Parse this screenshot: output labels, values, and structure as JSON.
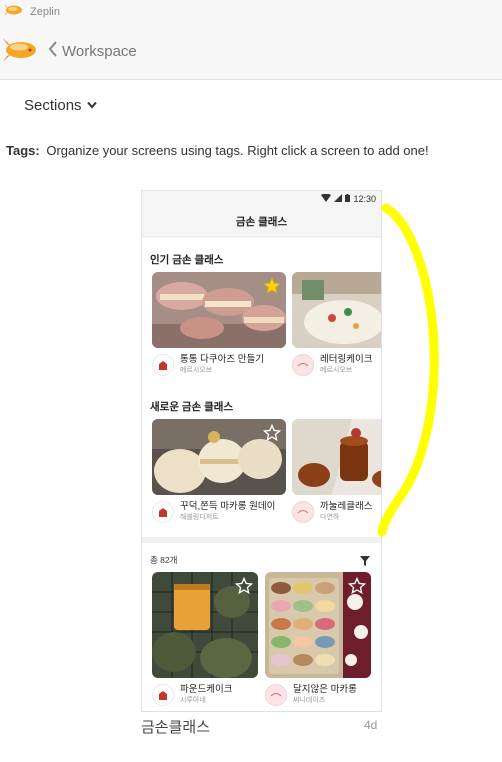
{
  "app": {
    "title": "Zeplin"
  },
  "nav": {
    "back_label": "Workspace"
  },
  "sections": {
    "label": "Sections"
  },
  "tags": {
    "label": "Tags:",
    "text": "Organize your screens using tags. Right click a screen to add one!"
  },
  "screen": {
    "name": "금손클래스",
    "age": "4d",
    "status_time": "12:30",
    "appbar_title": "금손 클래스",
    "popular": {
      "title": "인기 금손 클래스",
      "items": [
        {
          "title": "통통 다쿠아즈 만들기",
          "shop": "메르시오브",
          "favorite": true
        },
        {
          "title": "레터링케이크",
          "shop": "메르시오브",
          "favorite": false
        }
      ]
    },
    "new": {
      "title": "새로운 금손 클래스",
      "items": [
        {
          "title": "꾸덕,쫀득 마카롱 원데이",
          "shop": "해블링디저트",
          "favorite": false
        },
        {
          "title": "까눌레클래스",
          "shop": "다연하",
          "favorite": false
        }
      ]
    },
    "total": "총 82개",
    "grid": [
      {
        "title": "파운드케이크",
        "shop": "시루아네",
        "favorite": false
      },
      {
        "title": "달지않은 마카롱",
        "shop": "써니데이즈",
        "favorite": false
      }
    ]
  },
  "colors": {
    "annotation": "#ffff00",
    "star_filled": "#ffd400",
    "accent": "#f5a623"
  }
}
